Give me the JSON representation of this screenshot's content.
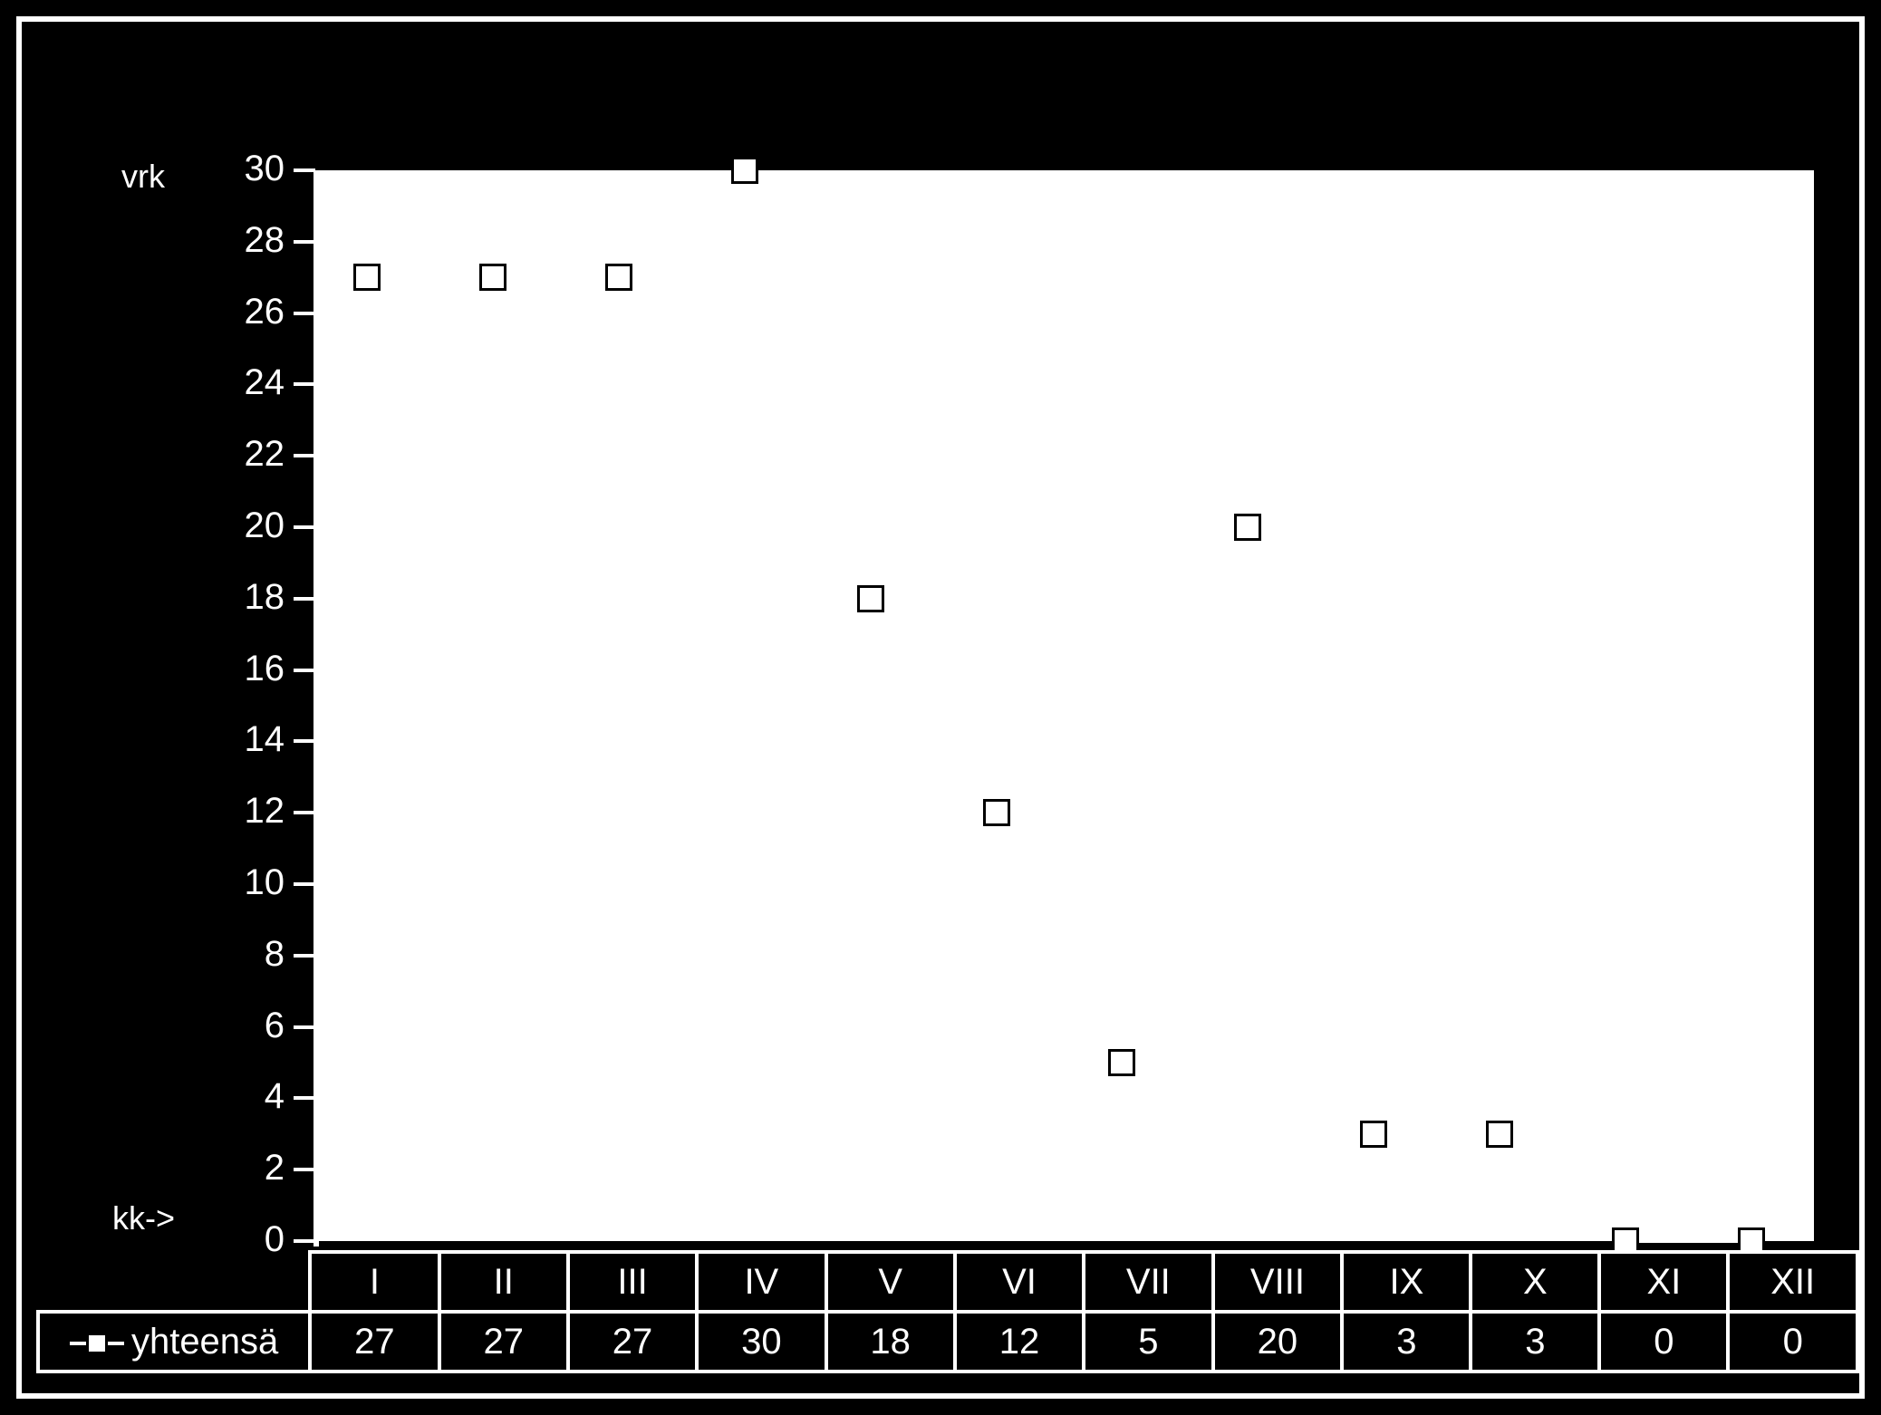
{
  "ylabel": "vrk",
  "xlabel": "kk->",
  "legend_label": "yhteensä",
  "chart_data": {
    "type": "line",
    "categories": [
      "I",
      "II",
      "III",
      "IV",
      "V",
      "VI",
      "VII",
      "VIII",
      "IX",
      "X",
      "XI",
      "XII"
    ],
    "series": [
      {
        "name": "yhteensä",
        "values": [
          27,
          27,
          27,
          30,
          18,
          12,
          5,
          20,
          3,
          3,
          0,
          0
        ]
      }
    ],
    "ylabel": "vrk",
    "xlabel": "kk->",
    "ylim": [
      0,
      30
    ],
    "ytick_step": 2
  }
}
